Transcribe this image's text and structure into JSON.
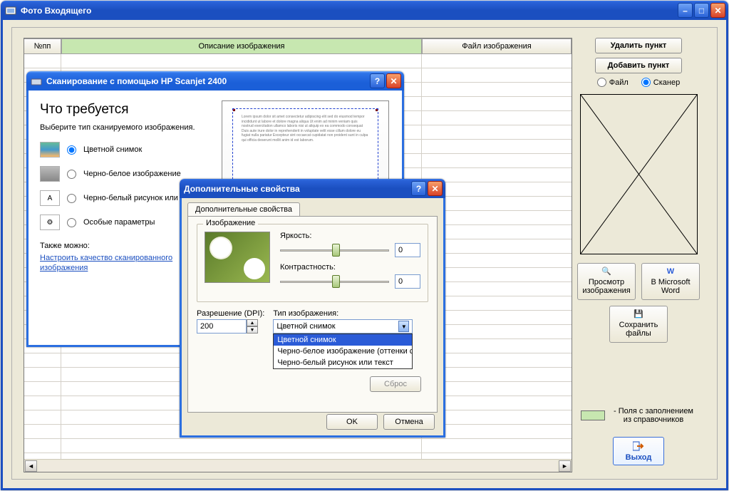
{
  "main_window": {
    "title": "Фото Входящего",
    "table": {
      "col_num": "№пп",
      "col_desc": "Описание изображения",
      "col_file": "Файл изображения"
    },
    "sidebar": {
      "delete_btn": "Удалить пункт",
      "add_btn": "Добавить пункт",
      "radio_file": "Файл",
      "radio_scanner": "Сканер",
      "tool_view": "Просмотр изображения",
      "tool_word": "В Microsoft Word",
      "tool_save": "Сохранить файлы",
      "legend_text": "- Поля с заполнением из справочников",
      "exit": "Выход"
    }
  },
  "scan_dialog": {
    "title": "Сканирование с помощью HP Scanjet 2400",
    "heading": "Что требуется",
    "subheading": "Выберите тип сканируемого изображения.",
    "opts": {
      "color": "Цветной снимок",
      "gray": "Черно-белое изображение (оттенки серого)",
      "bw": "Черно-белый рисунок или текст",
      "custom": "Особые параметры"
    },
    "also": "Также можно:",
    "link": "Настроить качество сканированного изображения"
  },
  "props_dialog": {
    "title": "Дополнительные свойства",
    "tab": "Дополнительные свойства",
    "group_image": "Изображение",
    "brightness_label": "Яркость:",
    "brightness_value": "0",
    "contrast_label": "Контрастность:",
    "contrast_value": "0",
    "dpi_label": "Разрешение (DPI):",
    "dpi_value": "200",
    "type_label": "Тип изображения:",
    "type_selected": "Цветной снимок",
    "type_options": [
      "Цветной снимок",
      "Черно-белое изображение (оттенки серого)",
      "Черно-белый рисунок или текст"
    ],
    "reset": "Сброс",
    "ok": "OK",
    "cancel": "Отмена"
  }
}
